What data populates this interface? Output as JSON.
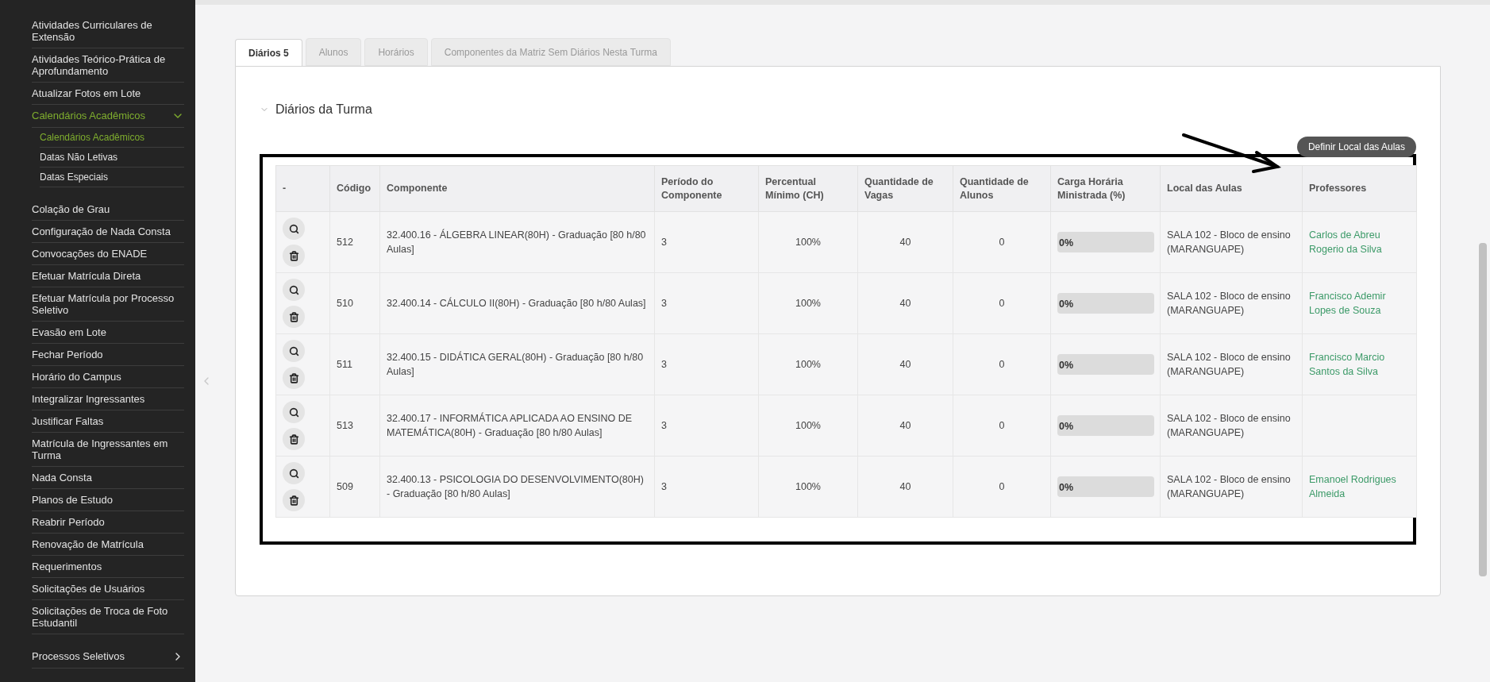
{
  "sidebar": {
    "sections": [
      {
        "items": [
          {
            "label": "Atividades Curriculares de Extensão"
          },
          {
            "label": "Atividades Teórico-Prática de Aprofundamento"
          },
          {
            "label": "Atualizar Fotos em Lote"
          },
          {
            "label": "Calendários Acadêmicos",
            "expanded": true,
            "children": [
              {
                "label": "Calendários Acadêmicos",
                "selected": true
              },
              {
                "label": "Datas Não Letivas",
                "selected": false
              },
              {
                "label": "Datas Especiais",
                "selected": false
              }
            ]
          },
          {
            "label": "Colação de Grau"
          },
          {
            "label": "Configuração de Nada Consta"
          },
          {
            "label": "Convocações do ENADE"
          },
          {
            "label": "Efetuar Matrícula Direta"
          },
          {
            "label": "Efetuar Matrícula por Processo Seletivo"
          },
          {
            "label": "Evasão em Lote"
          },
          {
            "label": "Fechar Período"
          },
          {
            "label": "Horário do Campus"
          },
          {
            "label": "Integralizar Ingressantes"
          },
          {
            "label": "Justificar Faltas"
          },
          {
            "label": "Matrícula de Ingressantes em Turma"
          },
          {
            "label": "Nada Consta"
          },
          {
            "label": "Planos de Estudo"
          },
          {
            "label": "Reabrir Período"
          },
          {
            "label": "Renovação de Matrícula"
          },
          {
            "label": "Requerimentos"
          },
          {
            "label": "Solicitações de Usuários"
          },
          {
            "label": "Solicitações de Troca de Foto Estudantil"
          }
        ]
      },
      {
        "items": [
          {
            "label": "Processos Seletivos",
            "expanded": false
          }
        ]
      }
    ]
  },
  "tabs": [
    {
      "label": "Diários 5",
      "selected": true
    },
    {
      "label": "Alunos",
      "selected": false
    },
    {
      "label": "Horários",
      "selected": false
    },
    {
      "label": "Componentes da Matriz Sem Diários Nesta Turma",
      "selected": false
    }
  ],
  "section": {
    "title": "Diários da Turma",
    "expanded": true,
    "action_button": "Definir Local das Aulas"
  },
  "table": {
    "columns": [
      "-",
      "Código",
      "Componente",
      "Período do Componente",
      "Percentual Mínimo (CH)",
      "Quantidade de Vagas",
      "Quantidade de Alunos",
      "Carga Horária Ministrada (%)",
      "Local das Aulas",
      "Professores"
    ],
    "rows": [
      {
        "codigo": "512",
        "componente": "32.400.16 - ÁLGEBRA LINEAR(80H) - Graduação [80 h/80 Aulas]",
        "periodo": "3",
        "percentual": "100%",
        "vagas": "40",
        "alunos": "0",
        "carga": {
          "label": "0%",
          "level": 0
        },
        "local": "SALA 102 - Bloco de ensino (MARANGUAPE)",
        "professores": "Carlos de Abreu Rogerio da Silva"
      },
      {
        "codigo": "510",
        "componente": "32.400.14 - CÁLCULO II(80H) - Graduação [80 h/80 Aulas]",
        "periodo": "3",
        "percentual": "100%",
        "vagas": "40",
        "alunos": "0",
        "carga": {
          "label": "0%",
          "level": 0
        },
        "local": "SALA 102 - Bloco de ensino (MARANGUAPE)",
        "professores": "Francisco Ademir Lopes de Souza"
      },
      {
        "codigo": "511",
        "componente": "32.400.15 - DIDÁTICA GERAL(80H) - Graduação [80 h/80 Aulas]",
        "periodo": "3",
        "percentual": "100%",
        "vagas": "40",
        "alunos": "0",
        "carga": {
          "label": "0%",
          "level": 0
        },
        "local": "SALA 102 - Bloco de ensino (MARANGUAPE)",
        "professores": "Francisco Marcio Santos da Silva"
      },
      {
        "codigo": "513",
        "componente": "32.400.17 - INFORMÁTICA APLICADA AO ENSINO DE MATEMÁTICA(80H) - Graduação [80 h/80 Aulas]",
        "periodo": "3",
        "percentual": "100%",
        "vagas": "40",
        "alunos": "0",
        "carga": {
          "label": "0%",
          "level": 0
        },
        "local": "SALA 102 - Bloco de ensino (MARANGUAPE)"
      },
      {
        "codigo": "509",
        "componente": "32.400.13 - PSICOLOGIA DO DESENVOLVIMENTO(80H) - Graduação [80 h/80 Aulas]",
        "periodo": "3",
        "percentual": "100%",
        "vagas": "40",
        "alunos": "0",
        "carga": {
          "label": "0%",
          "level": 0
        },
        "local": "SALA 102 - Bloco de ensino (MARANGUAPE)",
        "professores": "Emanoel Rodrigues Almeida"
      }
    ]
  }
}
